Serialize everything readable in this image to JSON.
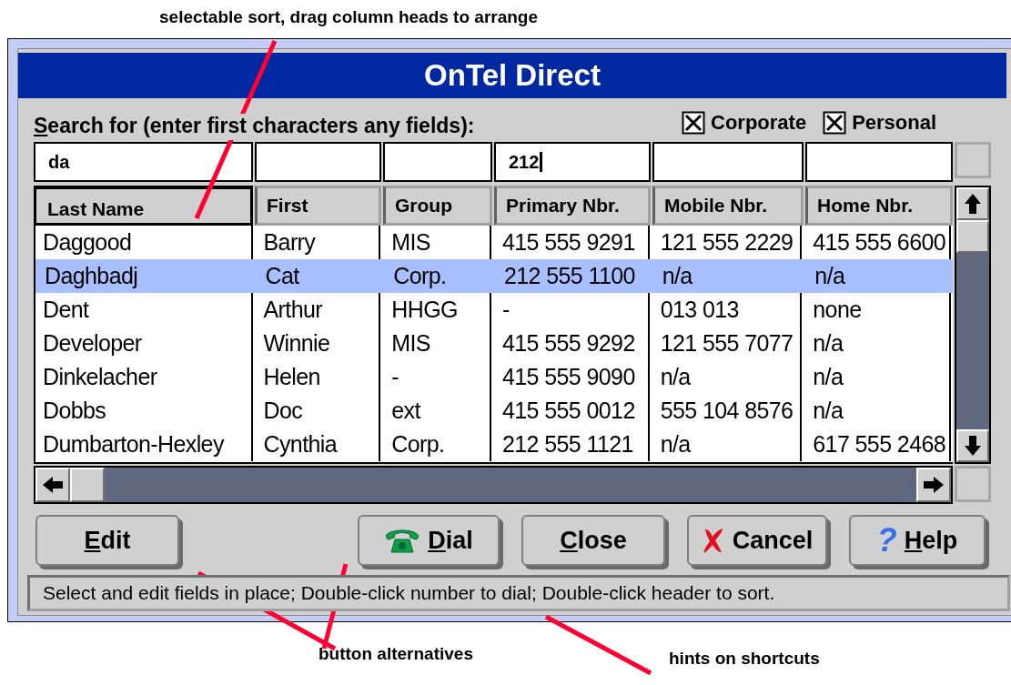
{
  "annotations": {
    "top": "selectable sort, drag column heads to arrange",
    "buttons": "button alternatives",
    "hints": "hints on shortcuts"
  },
  "window": {
    "title": "OnTel Direct"
  },
  "search": {
    "label": "Search for (enter first characters any fields):",
    "mnemonic": true,
    "filters": [
      {
        "label": "Corporate",
        "checked": true
      },
      {
        "label": "Personal",
        "checked": true
      }
    ],
    "fields": [
      {
        "value": "da",
        "focused": false
      },
      {
        "focused": false
      },
      {
        "focused": false
      },
      {
        "value": "212",
        "focused": true
      },
      {
        "focused": false
      },
      {
        "focused": false
      }
    ]
  },
  "table": {
    "columns": [
      {
        "label": "Last Name",
        "selected": true
      },
      {
        "label": "First",
        "selected": false
      },
      {
        "label": "Group",
        "selected": false
      },
      {
        "label": "Primary Nbr.",
        "selected": false
      },
      {
        "label": "Mobile Nbr.",
        "selected": false
      },
      {
        "label": "Home Nbr.",
        "selected": false
      }
    ],
    "rows": [
      {
        "cells": [
          "Daggood",
          "Barry",
          "MIS",
          "415 555 9291",
          "121 555 2229",
          "415 555 6600"
        ],
        "selected": false
      },
      {
        "cells": [
          "Daghbadj",
          "Cat",
          "Corp.",
          "212 555 1100",
          "n/a",
          "n/a"
        ],
        "selected": true
      },
      {
        "cells": [
          "Dent",
          "Arthur",
          "HHGG",
          "-",
          "013 013",
          "none"
        ],
        "selected": false
      },
      {
        "cells": [
          "Developer",
          "Winnie",
          "MIS",
          "415 555 9292",
          "121 555 7077",
          "n/a"
        ],
        "selected": false
      },
      {
        "cells": [
          "Dinkelacher",
          "Helen",
          "-",
          "415 555 9090",
          "n/a",
          "n/a"
        ],
        "selected": false
      },
      {
        "cells": [
          "Dobbs",
          "Doc",
          "ext",
          "415 555 0012",
          "555 104 8576",
          "n/a"
        ],
        "selected": false
      },
      {
        "cells": [
          "Dumbarton-Hexley",
          "Cynthia",
          "Corp.",
          "212 555 1121",
          "n/a",
          "617 555 2468"
        ],
        "selected": false
      }
    ]
  },
  "buttons": [
    {
      "label": "Edit",
      "mnemonic": true,
      "kind": "plain"
    },
    {
      "label": "Dial",
      "mnemonic": true,
      "kind": "phone"
    },
    {
      "label": "Close",
      "mnemonic": true,
      "kind": "plain"
    },
    {
      "label": "Cancel",
      "mnemonic": false,
      "kind": "cancel"
    },
    {
      "label": "Help",
      "mnemonic": true,
      "kind": "help",
      "icon_text": "?"
    }
  ],
  "status_bar": "Select and edit fields in place; Double-click number to dial; Double-click header to sort."
}
